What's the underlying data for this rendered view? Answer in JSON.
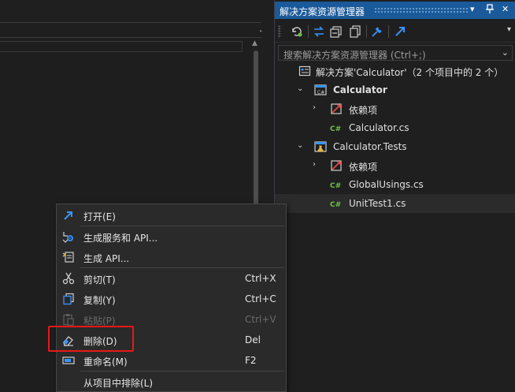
{
  "solution_explorer": {
    "title": "解决方案资源管理器",
    "search_placeholder": "搜索解决方案资源管理器 (Ctrl+;)",
    "tree": {
      "solution": "解决方案'Calculator'（2 个项目中的 2 个）",
      "project1": "Calculator",
      "project1_dependencies": "依赖项",
      "project1_file": "Calculator.cs",
      "project2": "Calculator.Tests",
      "project2_dependencies": "依赖项",
      "project2_file1": "GlobalUsings.cs",
      "project2_file2": "UnitTest1.cs"
    },
    "csharp_badge": "C#"
  },
  "context_menu": {
    "items": [
      {
        "label": "打开(E)",
        "shortcut": ""
      },
      {
        "label": "生成服务和 API...",
        "shortcut": ""
      },
      {
        "label": "生成 API...",
        "shortcut": ""
      },
      {
        "label": "剪切(T)",
        "shortcut": "Ctrl+X"
      },
      {
        "label": "复制(Y)",
        "shortcut": "Ctrl+C"
      },
      {
        "label": "粘贴(P)",
        "shortcut": "Ctrl+V"
      },
      {
        "label": "删除(D)",
        "shortcut": "Del"
      },
      {
        "label": "重命名(M)",
        "shortcut": "F2"
      },
      {
        "label": "从项目中排除(L)",
        "shortcut": ""
      }
    ]
  },
  "colors": {
    "title_bar": "#1b5a9a",
    "highlight_box": "#e81818",
    "accent_blue": "#3794ff"
  }
}
